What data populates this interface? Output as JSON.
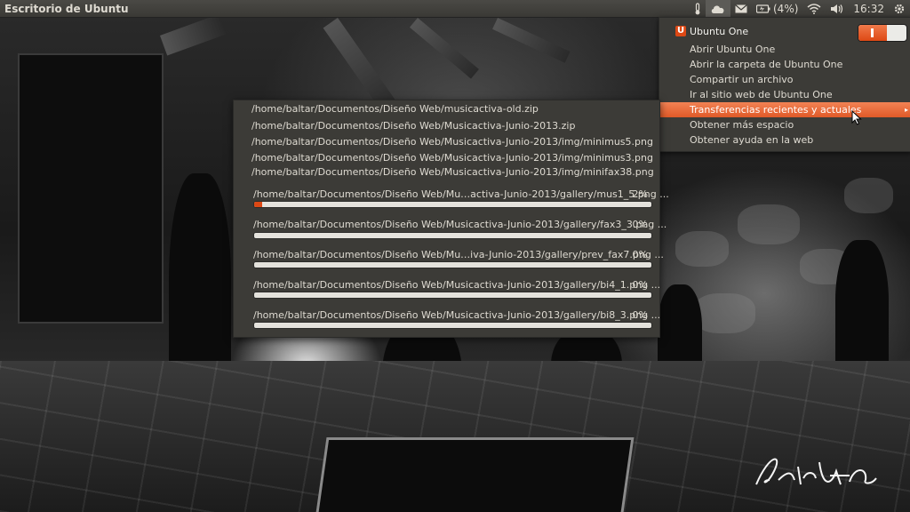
{
  "panel": {
    "title": "Escritorio de Ubuntu",
    "battery_text": "(4%)",
    "clock": "16:32",
    "icons": [
      "thermometer-icon",
      "ubuntu-one-cloud-icon",
      "mail-icon",
      "battery-icon",
      "wifi-icon",
      "volume-icon",
      "gear-icon"
    ]
  },
  "menu": {
    "header": "Ubuntu One",
    "header_icon": "U",
    "toggle_state": "on",
    "items": [
      {
        "label": "Abrir Ubuntu One"
      },
      {
        "label": "Abrir la carpeta de Ubuntu One"
      },
      {
        "label": "Compartir un archivo"
      },
      {
        "label": "Ir al sitio web de Ubuntu One"
      },
      {
        "label": "Transferencias recientes y actuales",
        "submenu_arrow": "▸"
      },
      {
        "label": "Obtener más espacio"
      },
      {
        "label": "Obtener ayuda en la web"
      }
    ]
  },
  "transfers": {
    "recent": [
      "/home/baltar/Documentos/Diseño Web/musicactiva-old.zip",
      "/home/baltar/Documentos/Diseño Web/Musicactiva-Junio-2013.zip",
      "/home/baltar/Documentos/Diseño Web/Musicactiva-Junio-2013/img/minimus5.png",
      "/home/baltar/Documentos/Diseño Web/Musicactiva-Junio-2013/img/minimus3.png",
      "/home/baltar/Documentos/Diseño Web/Musicactiva-Junio-2013/img/minifax38.png"
    ],
    "current": [
      {
        "label": "/home/baltar/Documentos/Diseño Web/Mu…activa-Junio-2013/gallery/mus1_5.png ...",
        "percent_text": "2%",
        "progress": 0.02
      },
      {
        "label": "/home/baltar/Documentos/Diseño Web/Musicactiva-Junio-2013/gallery/fax3_3.png ...",
        "percent_text": "0%",
        "progress": 0
      },
      {
        "label": "/home/baltar/Documentos/Diseño Web/Mu…iva-Junio-2013/gallery/prev_fax7.png ...",
        "percent_text": "0%",
        "progress": 0
      },
      {
        "label": "/home/baltar/Documentos/Diseño Web/Musicactiva-Junio-2013/gallery/bi4_1.png ...",
        "percent_text": "0%",
        "progress": 0
      },
      {
        "label": "/home/baltar/Documentos/Diseño Web/Musicactiva-Junio-2013/gallery/bi8_3.png ...",
        "percent_text": "0%",
        "progress": 0
      }
    ]
  },
  "colors": {
    "accent": "#dd4814",
    "panel_bg": "#3c3b37",
    "menu_text": "#dfdbd2"
  },
  "wallpaper": {
    "signature": "PatriciA Casal"
  }
}
